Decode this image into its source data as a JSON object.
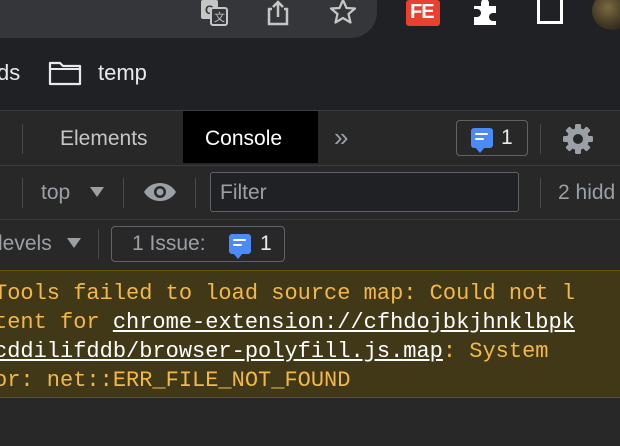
{
  "bookmarks": {
    "partial_label": "ds",
    "folder_label": "temp"
  },
  "devtools": {
    "tabs": {
      "elements": "Elements",
      "console": "Console",
      "more": "»"
    },
    "issues_count": "1",
    "toolbar": {
      "context": "top",
      "filter_placeholder": "Filter",
      "hidden": "2 hidd"
    },
    "levels_label": "levels",
    "issue_button": {
      "label": "1 Issue:",
      "count": "1"
    },
    "warning": {
      "line1": "Tools failed to load source map: Could not l",
      "line2_prefix": "tent for ",
      "line2_link": "chrome-extension://cfhdojbkjhnklbpk",
      "line3_link": "cddilifddb/browser-polyfill.js.map",
      "line3_suffix": ": System",
      "line4": "or: net::ERR_FILE_NOT_FOUND"
    }
  },
  "extensions": {
    "fe_label": "FE"
  }
}
